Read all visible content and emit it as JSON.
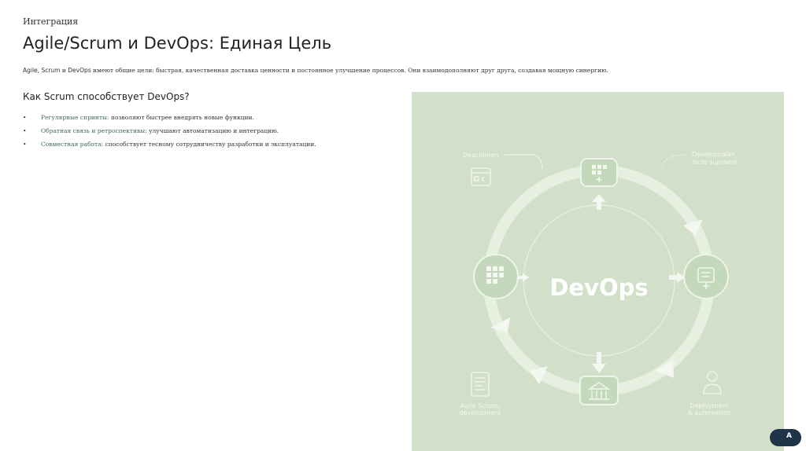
{
  "slide": {
    "section": "Интеграция",
    "title": "Agile/Scrum и DevOps: Единая Цель",
    "intro": {
      "terms": "Agile, Scrum",
      "and": "и",
      "devops": "DevOps",
      "rest": "имеют общие цели: быстрая, качественная доставка ценности и постоянное улучшение процессов. Они взаимодополняют друг друга, создавая мощную синергию."
    },
    "subheading": "Как Scrum способствует DevOps?",
    "bullets": [
      {
        "marker": "•",
        "term": "Регулярные спринты:",
        "text": "позволяют быстрее внедрять новые функции."
      },
      {
        "marker": "•",
        "term": "Обратная связь и ретроспективы:",
        "text": "улучшают автоматизацию и интеграцию."
      },
      {
        "marker": "•",
        "term": "Совместная работа:",
        "text": "способствует тесному сотрудничеству разработки и эксплуатации."
      }
    ]
  },
  "figure": {
    "center_label": "DevOps",
    "labels": {
      "top_left": "Deaclomen",
      "top_right_1": "Developpalim",
      "top_right_2": "dicto suprnent",
      "bottom_left_1": "Agile Scrum,",
      "bottom_left_2": "development",
      "bottom_right_1": "Deployment",
      "bottom_right_2": "& automation"
    },
    "icons": [
      "kanban-icon",
      "checklist-icon",
      "board-icon",
      "building-icon",
      "code-window-icon",
      "document-icon",
      "person-icon"
    ],
    "colors": {
      "background": "#d3e0c9",
      "ring": "#e7efe0",
      "node": "#c4d8bb",
      "text": "#ffffff"
    }
  },
  "badge": {
    "label": "A"
  }
}
